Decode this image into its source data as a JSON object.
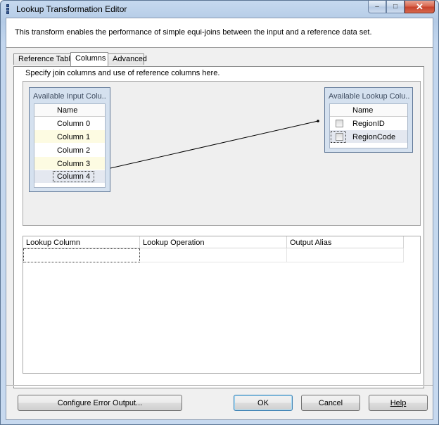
{
  "window": {
    "title": "Lookup Transformation Editor"
  },
  "header": {
    "description": "This transform enables the performance of simple equi-joins between the input and a reference data set."
  },
  "tabs": [
    {
      "label": "Reference Table",
      "active": false
    },
    {
      "label": "Columns",
      "active": true
    },
    {
      "label": "Advanced",
      "active": false
    }
  ],
  "columns_tab": {
    "description": "Specify join columns and use of reference columns here.",
    "input_box": {
      "title": "Available Input Colu...",
      "header": "Name",
      "items": [
        "Column 0",
        "Column 1",
        "Column 2",
        "Column 3",
        "Column 4"
      ]
    },
    "lookup_box": {
      "title": "Available Lookup Colu...",
      "header": "Name",
      "items": [
        "RegionID",
        "RegionCode"
      ]
    },
    "mapping": {
      "from": "Column 4",
      "to": "RegionCode"
    }
  },
  "grid": {
    "headers": [
      "Lookup Column",
      "Lookup Operation",
      "Output Alias"
    ]
  },
  "buttons": {
    "configure_error": "Configure Error Output...",
    "ok": "OK",
    "cancel": "Cancel",
    "help": "Help"
  }
}
